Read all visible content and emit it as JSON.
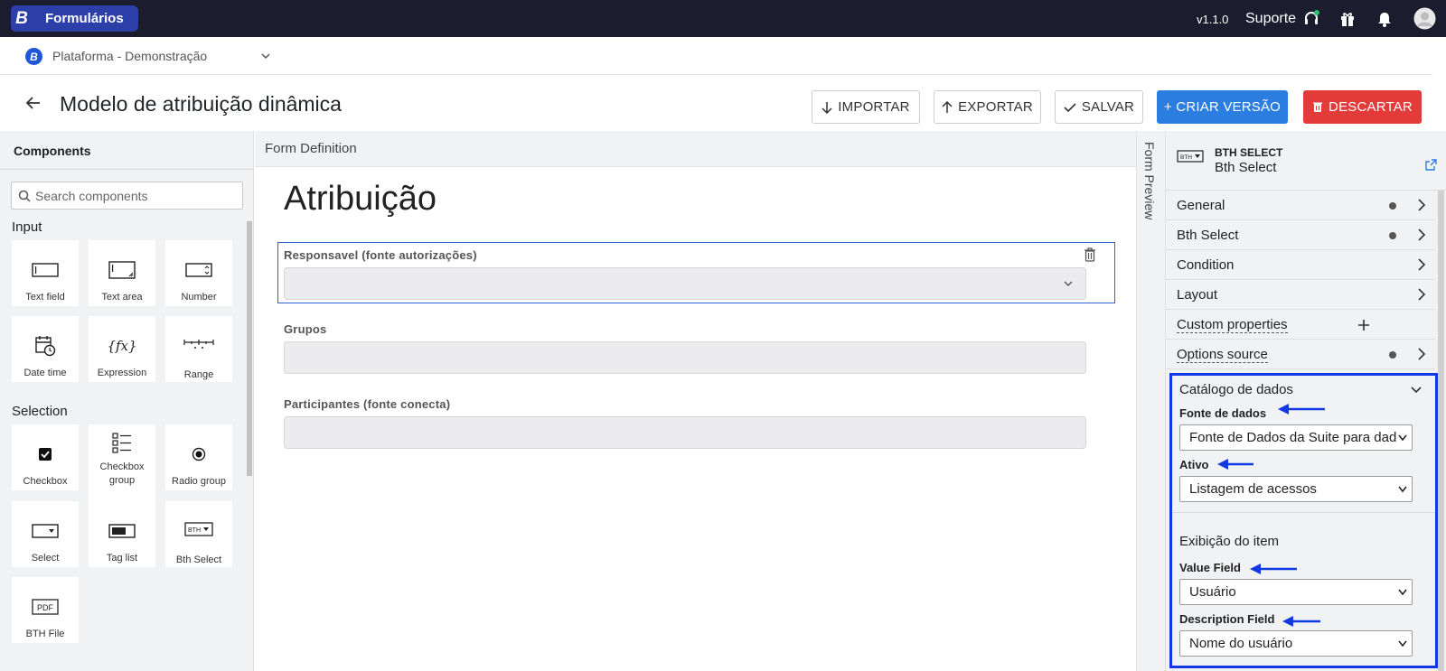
{
  "topbar": {
    "brand_letter": "B",
    "app_name": "Formulários",
    "version": "v1.1.0",
    "support_label": "Suporte"
  },
  "org": {
    "letter": "B",
    "name": "Plataforma - Demonstração"
  },
  "page": {
    "title": "Modelo de atribuição dinâmica",
    "buttons": {
      "import": "IMPORTAR",
      "export": "EXPORTAR",
      "save": "SALVAR",
      "create_version": "+ CRIAR VERSÃO",
      "discard": "DESCARTAR"
    }
  },
  "components": {
    "header": "Components",
    "search_placeholder": "Search components",
    "input_section": "Input",
    "input_items": [
      "Text field",
      "Text area",
      "Number",
      "Date time",
      "Expression",
      "Range"
    ],
    "selection_section": "Selection",
    "selection_items": [
      "Checkbox",
      "Checkbox group",
      "Radio group",
      "Select",
      "Tag list",
      "Bth Select",
      "BTH File"
    ]
  },
  "form": {
    "header": "Form Definition",
    "title": "Atribuição",
    "fields": [
      {
        "label": "Responsavel (fonte autorizações)"
      },
      {
        "label": "Grupos"
      },
      {
        "label": "Participantes (fonte conecta)"
      }
    ],
    "preview_label": "Form Preview"
  },
  "properties": {
    "type": "BTH SELECT",
    "name": "Bth Select",
    "icon_text": "BTH",
    "rows": [
      "General",
      "Bth Select",
      "Condition",
      "Layout",
      "Custom properties",
      "Options source"
    ],
    "catalog": {
      "title": "Catálogo de dados",
      "data_source_label": "Fonte de dados",
      "data_source_value": "Fonte de Dados da Suite para dad",
      "active_label": "Ativo",
      "active_value": "Listagem de acessos",
      "display_label": "Exibição do item",
      "value_field_label": "Value Field",
      "value_field_value": "Usuário",
      "description_field_label": "Description Field",
      "description_field_value": "Nome do usuário"
    }
  },
  "colors": {
    "topbar": "#1b1c2e",
    "brand": "#2c3fa8",
    "primary": "#2b7de0",
    "danger": "#e33a3a",
    "highlight": "#1238e4"
  }
}
